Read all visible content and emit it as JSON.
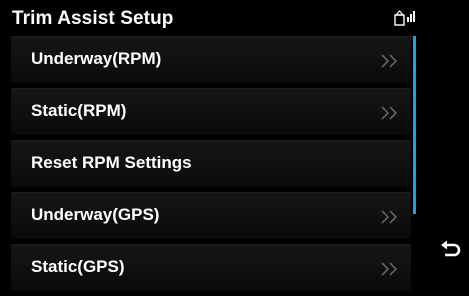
{
  "header": {
    "title": "Trim Assist Setup",
    "status_icon": "signal-icon"
  },
  "menu": {
    "items": [
      {
        "label": "Underway(RPM)",
        "has_chevron": true
      },
      {
        "label": "Static(RPM)",
        "has_chevron": true
      },
      {
        "label": "Reset RPM Settings",
        "has_chevron": false
      },
      {
        "label": "Underway(GPS)",
        "has_chevron": true
      },
      {
        "label": "Static(GPS)",
        "has_chevron": true
      }
    ]
  },
  "controls": {
    "back_icon": "back-arrow-icon"
  },
  "colors": {
    "background": "#000000",
    "text": "#ffffff",
    "scrollbar": "#1aa3e0",
    "chevron": "#6a6a6a"
  }
}
